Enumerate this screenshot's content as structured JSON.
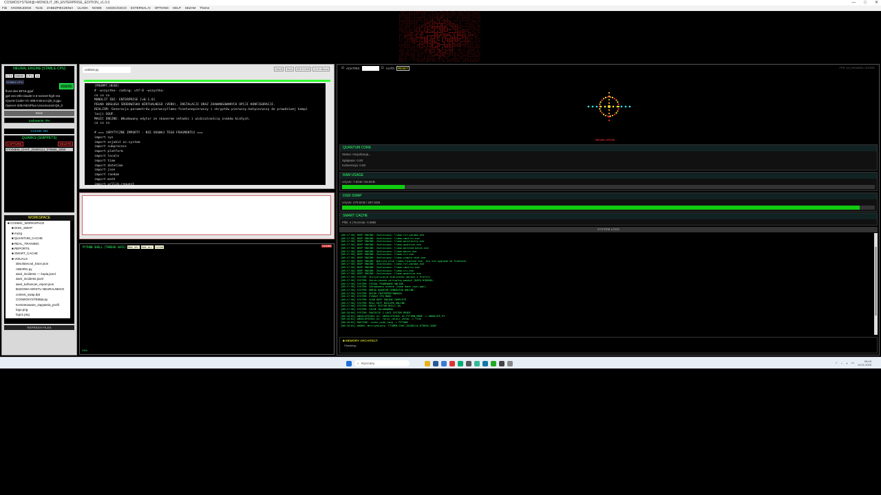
{
  "window": {
    "title": "COSMOSYSTEM@>MONOLIT_IBI_ENTERPRISE_EDITION_v1.0.0",
    "controls": [
      "—",
      "□",
      "✕"
    ]
  },
  "menu": [
    "File",
    "KNOWLEDGE",
    "Tools",
    "ZABEZPIECZENIA",
    "ULAMA",
    "NOWE",
    "ASSOC/CECO",
    "EXTERNAL AI",
    "OPTIONS",
    "HELP",
    "SEZAM",
    "Theme"
  ],
  "left": {
    "engine_title": "NEURAL ENGINE [STABLE-CPU]",
    "ctx_label": "CTX",
    "ctx_value": "99999",
    "cpu_label": "CPU",
    "cpu_value": "16",
    "stable_badge": "STABLE CPU",
    "ignite_label": "IGNITE",
    "models": [
      "flux2-dev-BF16.gguf",
      "gpt-oss-20b-claude-4.5-sonnet-high-rea",
      "IQuest-Coder-V1-40B-Instruct.Q8_0.ggu",
      "OpenAI-20B-NEOPlus-Uncensored-Q8_0"
    ],
    "idle": "IDLE",
    "loading": "Ładowanie: 0%",
    "cache": "CACHE: ON",
    "quarks_title": "QUARKS (SNIPPETS)",
    "capture_label": "CAPTURE",
    "delete_label": "DELETE",
    "quark_item": "CTXMEM_CHAT_20260114_075656_3200",
    "workspace_title": "WORKSPACE",
    "tree": [
      "■ COSMIC_WORKSPACE",
      "■ DISK_SWAP",
      "■ mozg",
      "■ QUANTUM_CACHE",
      "■ REAL_TRAINING",
      "■ REPORTS",
      "■ SMART_CACHE",
      "■ VISUALS",
      "absolutecool_trace.json",
      "AIBORG.py",
      "aiwir_incidents — kopia.jsonl",
      "aiwir_incidents.jsonl",
      "aiwir_turboscan_report.json",
      "BUDOWA MOSTU NEURALNEGO",
      "context_swap.dat",
      "COSMOSYSTEMipt.py",
      "Komentowane_zapytania_profil",
      "logo.png",
      "logo1.png"
    ],
    "refresh_label": "REFRESH FILES"
  },
  "editor": {
    "filename": "untitled.py",
    "buttons": [
      "SAVE",
      "RUN",
      "RESTORE",
      "CLR+Bleed"
    ],
    "code": "[PROMPT_HEAD]\n# -wszystko- coding: utf-8 -wszystko-\nco co co\nMONOLIT IBI: ENTERPRISE [v0.1.0]\nPEŁNA OBSŁUGA ŚRODOWISKA WIRTUALNEGO (VENV), INSTALACJI ORAZ ZAAWANSOWANYCH OPCJI KONFIGURACJI.\nREALISM: Generacja parametrów pierwszyllama-finetunepierwszy i skryptów pierwszy.batpierwszy do prawdziwej kompi\nlacji GGUF.\nMAGIC ENGINE: Wbudowany edytor ze skanerem składni i widzialnością znaków białych.\nco co co\n\n# === [KRYTYCZNE IMPORTY - NIE USUWAJ TEGO FRAGMENTU] ===\nimport sys\nimport osjakiś os.system\nimport subprocess\nimport platform\nimport locale\nimport time\nimport datetime\nimport json\nimport random\nimport math\nimport urllib.request"
  },
  "shell": {
    "title": "PYTHON SHELL [THREAD SAFE]",
    "buttons": [
      "RUN_SEL",
      "RUN_ALL",
      "CLEAR"
    ],
    "clear_label": "CLEAR",
    "prompt": ">>>"
  },
  "right": {
    "acktrix_label": "ACKTRIX",
    "auto_label": "AUTO",
    "reset_label": "RESET",
    "status": "FPS: 34 | RENDER: CHORD",
    "revelation": "REVELATION",
    "quantum": {
      "title": "QUANTUM CORE",
      "status": "Status: Inicjalizacja...",
      "entangle": "Splątanie: 0.00",
      "coherence": "Koherencja: 0.00"
    },
    "ram": {
      "title": "RAM USAGE",
      "text": "Użycie: 7.5GB / 63.9GB",
      "fill": 0.117
    },
    "swap": {
      "title": "DISK SWAP",
      "text": "Użycie: 279.6GB / 287.6GB",
      "fill": 0.972
    },
    "smart": {
      "title": "SMART CACHE",
      "text": "Pliki: 4 | Rozmiar: 0.0MB"
    },
    "logs_title": "SYSTEM LOGS",
    "logs": "[08:17:58] DEEP ENGINE: Znaleziono: llama-fit-params.exe\n[08:17:58] DEEP ENGINE: Znaleziono: llama-imatrix.exe\n[08:17:58] DEEP ENGINE: Znaleziono: llama-perplexity.exe\n[08:17:58] DEEP ENGINE: Znaleziono: llama-quantize.exe\n[08:17:58] DEEP ENGINE: Znaleziono: llama-batched-bench.exe\n[08:17:58] DEEP ENGINE: Znaleziono: llama-bench.exe\n[08:17:58] DEEP ENGINE: Znaleziono: llama-cli.exe\n[08:17:58] DEEP ENGINE: Znaleziono: llama-simple-chat.exe\n[08:17:58] DEEP ENGINE: Wykryto plik llama-finetune.exe, ale nie wygląda na finetune.\n[08:17:58] DEEP ENGINE: Znaleziono: llama-fit-params.exe\n[08:17:58] DEEP ENGINE: Znaleziono: llama-imatrix.exe\n[08:17:58] DEEP ENGINE: Znaleziono: llama-cli.exe\n[08:17:58] DEEP ENGINE: Znaleziono: llama-quantize.exe\n[08:17:58] SYSTEM: Inicjalizacja biblioteki obrazu i Profili.\n[08:17:58] SYSTEM: Zainicjowano wirtualną pamięć (DATA-HIDDEN).\n[08:17:58] SYSTEM: VISUAL FRAMEWORK ONLINE.\n[08:17:58] SYSTEM: Załadowano wiedzę (nowe dane json.pgn).\n[08:17:58] SYSTEM: OMEGA QUANTUM GENERATOR ONLINE.\n[08:17:58] SYSTEM: OKIEM ZINTERPRETOWANIA.\n[08:17:58] SYSTEM: STABLE CPU MODE.\n[08:17:58] SYSTEM: SCAN DEEP ENGINE COMPLETE.\n[08:17:58] SYSTEM: REAL EDIT BUILDER ONLINE.\n[08:17:58] SYSTEM: MAGIC EDITOR BUILT-IN.\n[08:17:58] SYSTEM: CACHE ZALADOWANO.\n[08:18:00] SYSTEM: PAKIECIE I LOGI SYSTEM READY.\n[08:18:02] ABSOLUTECOOL AI: ABSOLUTECOOL_AI_PYTHON_MODE -> ABSOLUTE_PY\n[08:18:02] ABSOLUTECOOL AI: force_colour_ustaw -> True\n[08:18:02] ROUTING: route_code_lang -> PYTHON\n[08:18:02] QUARK: Wstrzyknięto 'CTXMEM_CHAT_20260114_075656_3200'",
    "memory_title": "MEMORY ARCHITECT",
    "memory_status": "Checking..."
  },
  "taskbar": {
    "search_placeholder": "Wyszukaj",
    "time": "08:18",
    "date": "14.01.2026"
  },
  "colors": {
    "accent_green": "#33ff66",
    "alert_red": "#cc3333",
    "bar_green": "#11cc11"
  }
}
